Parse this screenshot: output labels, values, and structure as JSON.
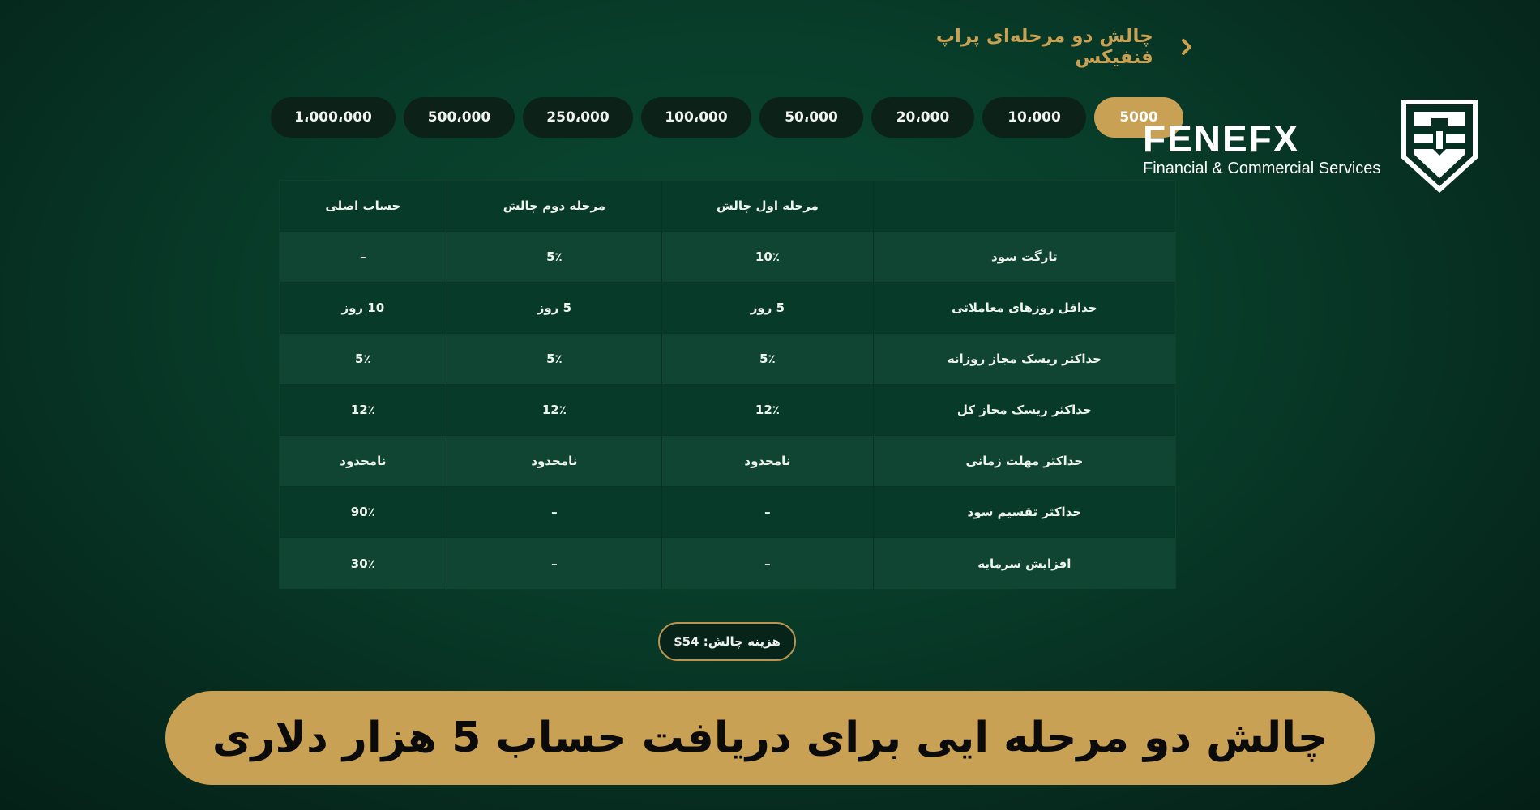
{
  "header": {
    "title": "چالش دو مرحله‌ای پراپ فنفیکس",
    "back_icon": "chevron-right-icon"
  },
  "amount_tabs": [
    {
      "label": "5000",
      "active": true
    },
    {
      "label": "10،000",
      "active": false
    },
    {
      "label": "20،000",
      "active": false
    },
    {
      "label": "50،000",
      "active": false
    },
    {
      "label": "100،000",
      "active": false
    },
    {
      "label": "250،000",
      "active": false
    },
    {
      "label": "500،000",
      "active": false
    },
    {
      "label": "1،000،000",
      "active": false
    }
  ],
  "logo": {
    "brand": "FENEFX",
    "subtitle": "Financial & Commercial Services",
    "icon": "shield-logo-icon"
  },
  "table": {
    "columns": [
      "",
      "مرحله اول چالش",
      "مرحله دوم چالش",
      "حساب اصلی"
    ],
    "rows": [
      {
        "label": "تارگت سود",
        "phase1": "10٪",
        "phase2": "5٪",
        "main": "–"
      },
      {
        "label": "حداقل روزهای معاملاتی",
        "phase1": "5 روز",
        "phase2": "5 روز",
        "main": "10 روز"
      },
      {
        "label": "حداکثر ریسک مجاز روزانه",
        "phase1": "5٪",
        "phase2": "5٪",
        "main": "5٪"
      },
      {
        "label": "حداکثر ریسک مجاز کل",
        "phase1": "12٪",
        "phase2": "12٪",
        "main": "12٪"
      },
      {
        "label": "حداکثر مهلت زمانی",
        "phase1": "نامحدود",
        "phase2": "نامحدود",
        "main": "نامحدود"
      },
      {
        "label": "حداکثر تقسیم سود",
        "phase1": "–",
        "phase2": "–",
        "main": "90٪"
      },
      {
        "label": "افزایش سرمایه",
        "phase1": "–",
        "phase2": "–",
        "main": "30٪"
      }
    ]
  },
  "fee": {
    "label": "هزینه چالش: 54$"
  },
  "banner": {
    "text": "چالش دو مرحله ایی برای دریافت حساب 5 هزار دلاری"
  },
  "colors": {
    "accent": "#c9a154",
    "background": "#083d2a",
    "pill": "#0c2219"
  }
}
